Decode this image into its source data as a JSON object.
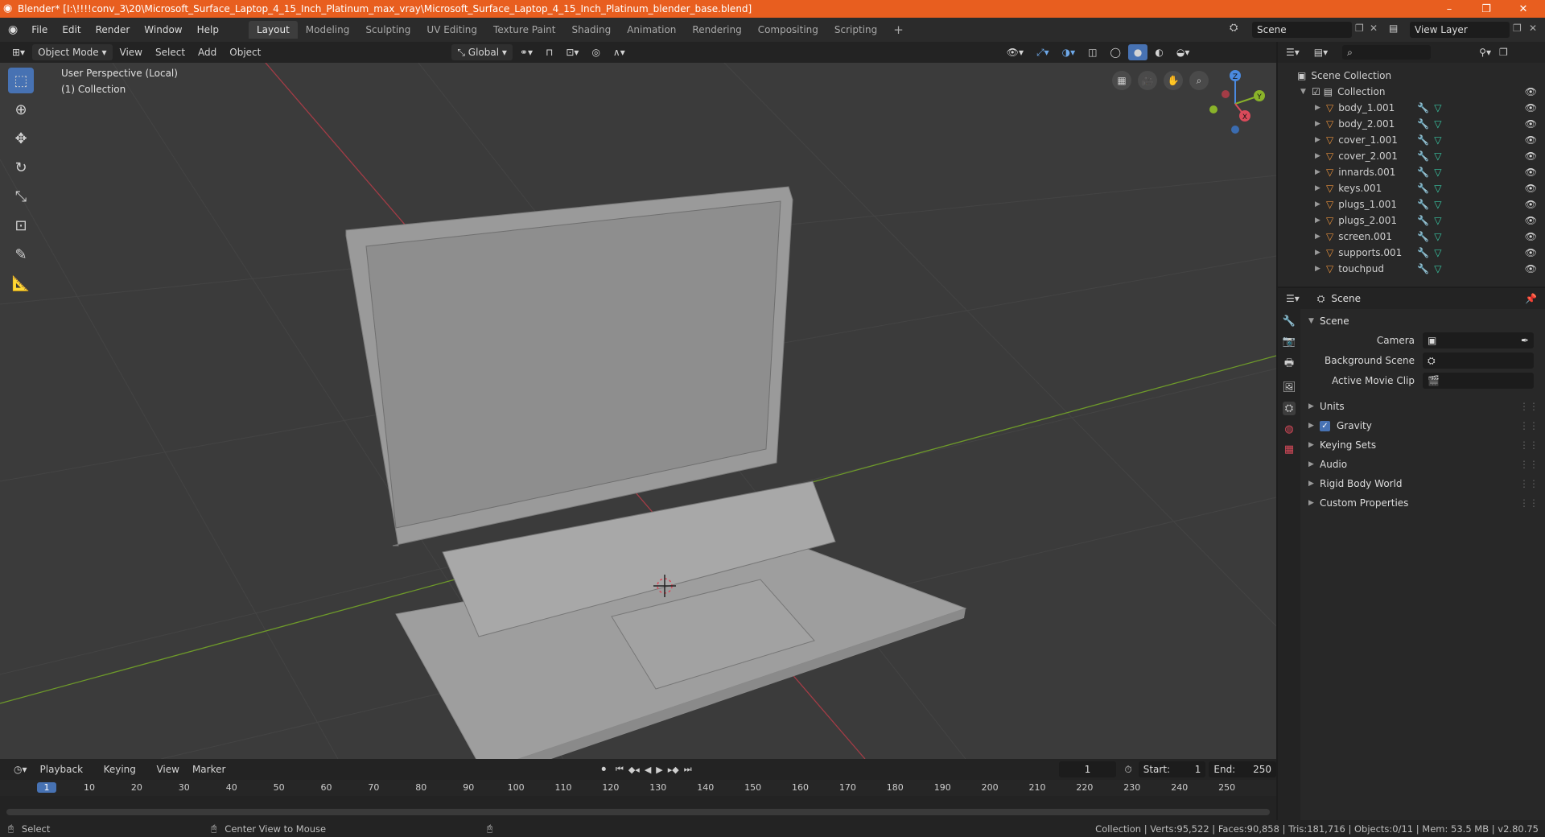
{
  "window": {
    "title": "Blender* [I:\\!!!!conv_3\\20\\Microsoft_Surface_Laptop_4_15_Inch_Platinum_max_vray\\Microsoft_Surface_Laptop_4_15_Inch_Platinum_blender_base.blend]",
    "minimize": "–",
    "maximize": "❐",
    "close": "✕"
  },
  "menu": [
    "File",
    "Edit",
    "Render",
    "Window",
    "Help"
  ],
  "workspaces": [
    "Layout",
    "Modeling",
    "Sculpting",
    "UV Editing",
    "Texture Paint",
    "Shading",
    "Animation",
    "Rendering",
    "Compositing",
    "Scripting"
  ],
  "add_workspace": "+",
  "scene_selector": "Scene",
  "view_layer": "View Layer",
  "viewport_header": {
    "mode": "Object Mode",
    "menus": [
      "View",
      "Select",
      "Add",
      "Object"
    ],
    "transform": "Global"
  },
  "viewport": {
    "perspective": "User Perspective (Local)",
    "collection": "(1) Collection",
    "gizmo": {
      "x": "X",
      "y": "Y",
      "z": "Z"
    }
  },
  "outliner": {
    "root": "Scene Collection",
    "collection": "Collection",
    "objects": [
      "body_1.001",
      "body_2.001",
      "cover_1.001",
      "cover_2.001",
      "innards.001",
      "keys.001",
      "plugs_1.001",
      "plugs_2.001",
      "screen.001",
      "supports.001",
      "touchpud"
    ]
  },
  "properties": {
    "context": "Scene",
    "section": "Scene",
    "fields": [
      {
        "label": "Camera"
      },
      {
        "label": "Background Scene"
      },
      {
        "label": "Active Movie Clip"
      }
    ],
    "panels": [
      "Units",
      "Gravity",
      "Keying Sets",
      "Audio",
      "Rigid Body World",
      "Custom Properties"
    ]
  },
  "timeline": {
    "menus": [
      "Playback",
      "Keying",
      "View",
      "Marker"
    ],
    "current_frame": "1",
    "start_label": "Start:",
    "start": "1",
    "end_label": "End:",
    "end": "250",
    "ruler": [
      "1",
      "10",
      "20",
      "30",
      "40",
      "50",
      "60",
      "70",
      "80",
      "90",
      "100",
      "110",
      "120",
      "130",
      "140",
      "150",
      "160",
      "170",
      "180",
      "190",
      "200",
      "210",
      "220",
      "230",
      "240",
      "250"
    ]
  },
  "status": {
    "select": "Select",
    "center": "Center View to Mouse",
    "stats": "Collection | Verts:95,522 | Faces:90,858 | Tris:181,716 | Objects:0/11 | Mem: 53.5 MB | v2.80.75"
  },
  "colors": {
    "titlebar": "#e85e1f",
    "active_tool": "#4772b3",
    "object_icon": "#e8913b",
    "mesh_icon": "#39c9a5",
    "x_axis": "#d94a5a",
    "y_axis": "#8ab32a",
    "z_axis": "#4a8ae0"
  }
}
